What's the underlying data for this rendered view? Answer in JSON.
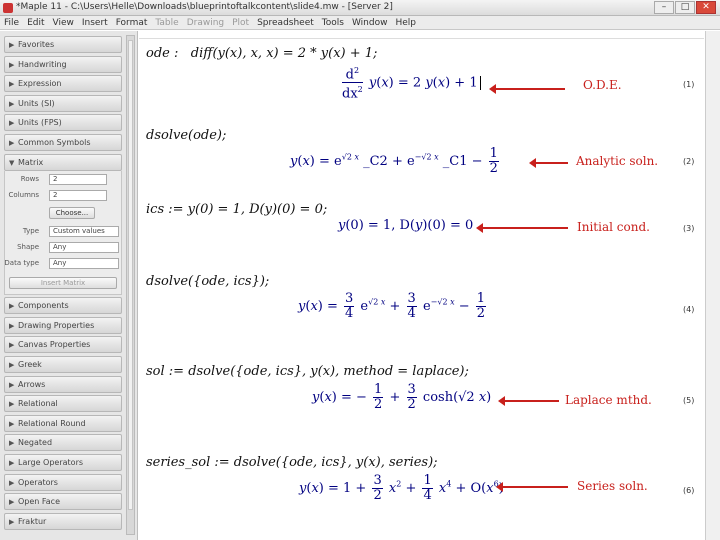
{
  "window": {
    "title": "*Maple 11 - C:\\Users\\Helle\\Downloads\\blueprintoftalkcontent\\slide4.mw - [Server 2]",
    "minimize": "–",
    "maximize": "□",
    "close": "✕"
  },
  "menu": [
    "File",
    "Edit",
    "View",
    "Insert",
    "Format",
    "Table",
    "Drawing",
    "Plot",
    "Spreadsheet",
    "Tools",
    "Window",
    "Help"
  ],
  "palettes": [
    "Favorites",
    "Handwriting",
    "Expression",
    "Units (SI)",
    "Units (FPS)",
    "Common Symbols",
    "Matrix"
  ],
  "matrix_panel": {
    "rows_label": "Rows",
    "rows_value": "2",
    "columns_label": "Columns",
    "columns_value": "2",
    "choose_button": "Choose...",
    "type_label": "Type",
    "type_value": "Custom values",
    "shape_label": "Shape",
    "shape_value": "Any",
    "datatype_label": "Data type",
    "datatype_value": "Any",
    "insert_button": "Insert Matrix"
  },
  "palettes_after": [
    "Components",
    "Drawing Properties",
    "Canvas Properties",
    "Greek",
    "Arrows",
    "Relational",
    "Relational Round",
    "Negated",
    "Large Operators",
    "Operators",
    "Open Face",
    "Fraktur"
  ],
  "annotations": {
    "ode": "O.D.E.",
    "analytic": "Analytic soln.",
    "initial": "Initial cond.",
    "laplace": "Laplace mthd.",
    "series": "Series soln."
  },
  "equation_labels": [
    "(1)",
    "(2)",
    "(3)",
    "(4)",
    "(5)",
    "(6)"
  ]
}
